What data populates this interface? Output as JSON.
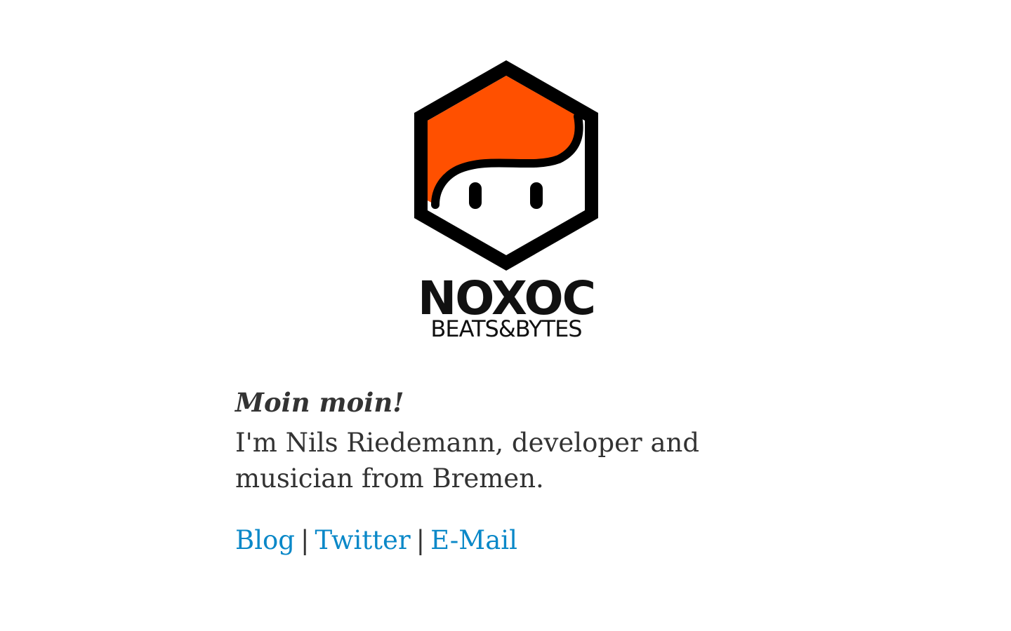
{
  "logo": {
    "title": "NOXOC",
    "subtitle": "BEATS&BYTES",
    "hair_color": "#ff5000",
    "outline_color": "#000000",
    "face_color": "#ffffff"
  },
  "greeting": "Moin moin!",
  "intro": "I'm Nils Riedemann, developer and musician from Bremen.",
  "links": [
    {
      "label": "Blog"
    },
    {
      "label": "Twitter"
    },
    {
      "label": "E-Mail"
    }
  ],
  "separator": "|",
  "colors": {
    "text": "#333333",
    "link": "#0a88c8",
    "background": "#ffffff"
  }
}
